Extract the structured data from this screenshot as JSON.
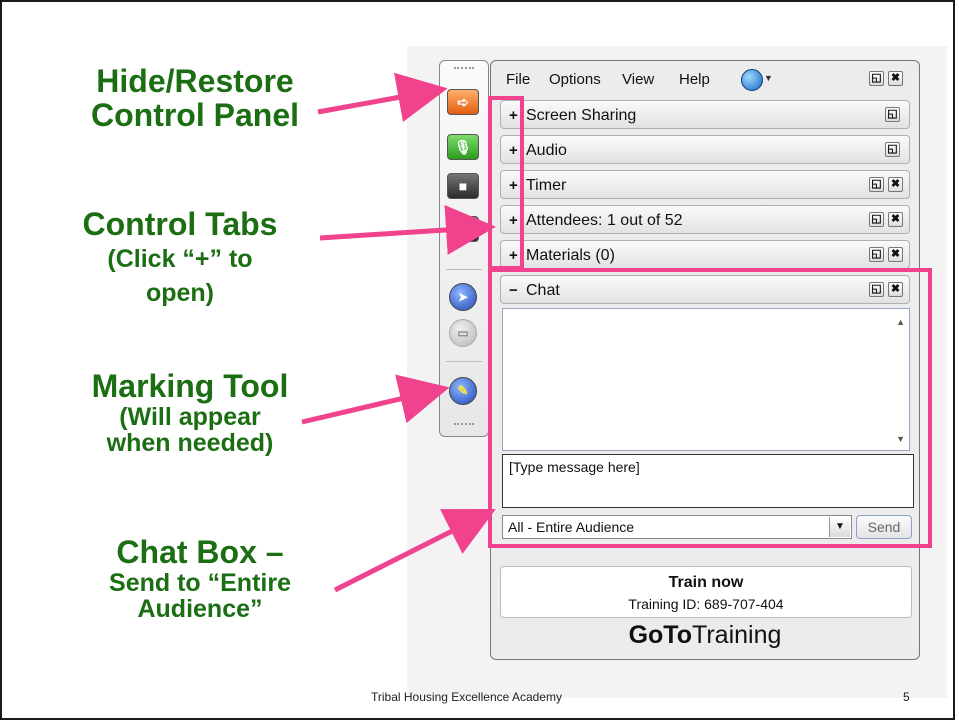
{
  "annotations": {
    "hide_restore": {
      "line1": "Hide/Restore",
      "line2": "Control Panel"
    },
    "control_tabs": {
      "line1": "Control Tabs",
      "line2": "(Click “+” to",
      "line3": "open)"
    },
    "marking_tool": {
      "line1": "Marking Tool",
      "line2": "(Will appear",
      "line3": "when needed)"
    },
    "chat_box": {
      "line1": "Chat Box –",
      "line2": "Send to “Entire",
      "line3": "Audience”"
    }
  },
  "menu": [
    "File",
    "Options",
    "View",
    "Help"
  ],
  "window_buttons": {
    "restore": "◱",
    "close": "✖"
  },
  "tabs": [
    {
      "toggle": "+",
      "label": "Screen Sharing"
    },
    {
      "toggle": "+",
      "label": "Audio"
    },
    {
      "toggle": "+",
      "label": "Timer"
    },
    {
      "toggle": "+",
      "label": "Attendees:  1 out of 52"
    },
    {
      "toggle": "+",
      "label": "Materials (0)"
    },
    {
      "toggle": "−",
      "label": "Chat"
    }
  ],
  "chat": {
    "message_placeholder": "[Type message here]",
    "audience_selected": "All - Entire Audience",
    "send_label": "Send"
  },
  "training": {
    "title": "Train now",
    "id_line": "Training ID: 689-707-404"
  },
  "brand": {
    "bold": "GoTo",
    "regular": "Training"
  },
  "footer": {
    "text": "Tribal Housing Excellence Academy",
    "page": "5"
  },
  "colors": {
    "annotation_green": "#1b6e12",
    "highlight_pink": "#f0428d"
  }
}
